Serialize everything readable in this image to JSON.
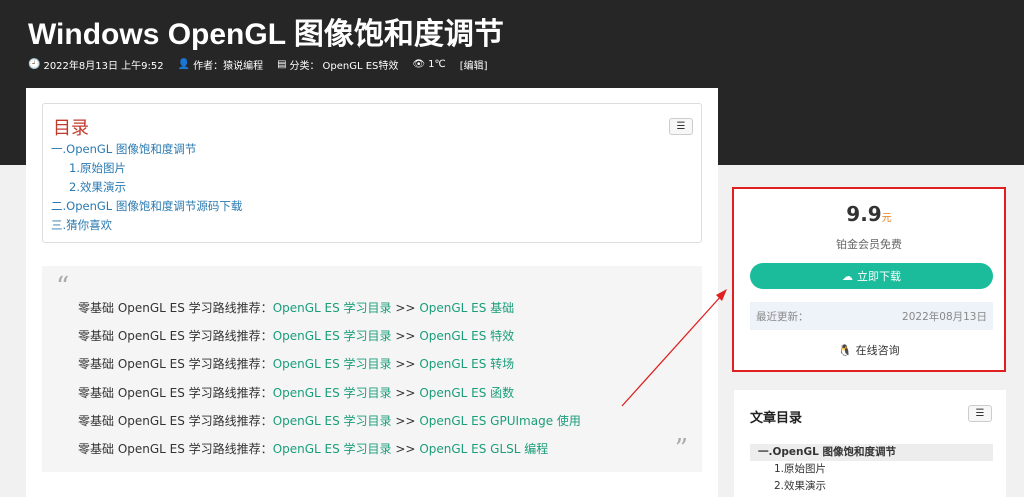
{
  "header": {
    "title": "Windows OpenGL 图像饱和度调节",
    "meta": {
      "date": "2022年8月13日 上午9:52",
      "author": "作者：猿说编程",
      "category_label": "分类：",
      "category": "OpenGL ES特效",
      "views": "1℃",
      "edit": "[编辑]"
    }
  },
  "toc": {
    "title": "目录",
    "items": [
      "一.OpenGL 图像饱和度调节",
      "1.原始图片",
      "2.效果演示",
      "二.OpenGL 图像饱和度调节源码下载",
      "三.猜你喜欢"
    ]
  },
  "quote": {
    "mark_open": "“",
    "mark_close": "”",
    "prefix": "零基础 OpenGL ES 学习路线推荐：",
    "link_catalog": "OpenGL ES 学习目录",
    "sep": " >> ",
    "targets": [
      "OpenGL ES 基础",
      "OpenGL ES 特效",
      "OpenGL ES 转场",
      "OpenGL ES 函数",
      "OpenGL ES GPUImage 使用",
      "OpenGL ES GLSL 编程"
    ]
  },
  "sidebar": {
    "price": "9.9",
    "price_unit": "元",
    "free_text": "铂金会员免费",
    "download_label": "立即下载",
    "update_label": "最近更新：",
    "update_date": "2022年08月13日",
    "consult_label": "在线咨询",
    "toc_title": "文章目录",
    "toc_items": [
      "一.OpenGL 图像饱和度调节",
      "1.原始图片",
      "2.效果演示"
    ]
  },
  "colors": {
    "accent": "#1abc9c",
    "highlight_border": "#e02020",
    "header_bg": "#262626",
    "link": "#2a7ab0"
  }
}
